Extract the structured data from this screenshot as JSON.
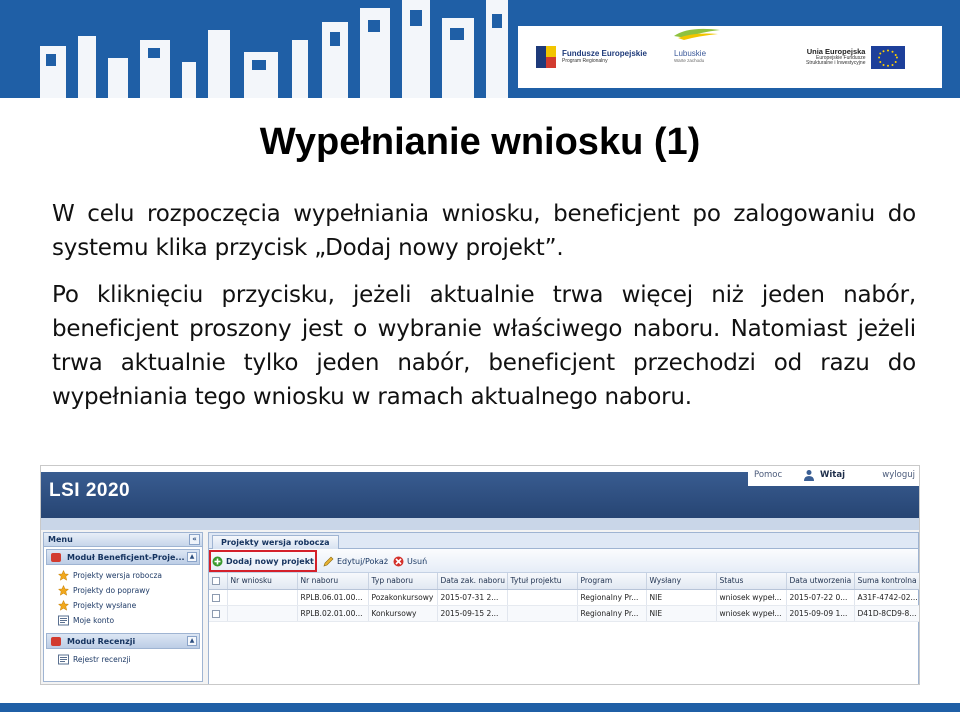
{
  "slide": {
    "title": "Wypełnianie wniosku (1)",
    "paragraph1": "W celu rozpoczęcia wypełniania wniosku, beneficjent po zalogowaniu do systemu klika przycisk „Dodaj nowy projekt”.",
    "paragraph2": "Po kliknięciu przycisku, jeżeli aktualnie trwa więcej niż jeden nabór, beneficjent proszony jest o wybranie właściwego naboru. Natomiast jeżeli trwa aktualnie tylko jeden nabór, beneficjent przechodzi od razu do wypełniania tego wniosku w ramach aktualnego naboru."
  },
  "logos": {
    "funds_name": "Fundusze Europejskie",
    "funds_sub": "Program Regionalny",
    "region_name": "Lubuskie",
    "region_sub": "Warte zachodu",
    "eu_name": "Unia Europejska",
    "eu_sub1": "Europejskie Fundusze",
    "eu_sub2": "Strukturalne i Inwestycyjne"
  },
  "app": {
    "logo": "LSI 2020",
    "topbar": {
      "help": "Pomoc",
      "hello": "Witaj",
      "logout": "wyloguj"
    },
    "menu": {
      "title": "Menu",
      "collapse": "«",
      "module1": {
        "title": "Moduł Beneficjent-Proje...",
        "items": [
          "Projekty wersja robocza",
          "Projekty do poprawy",
          "Projekty wysłane",
          "Moje konto"
        ]
      },
      "module2": {
        "title": "Moduł Recenzji",
        "items": [
          "Rejestr recenzji"
        ]
      }
    },
    "main": {
      "tab": "Projekty wersja robocza",
      "toolbar": {
        "add": "Dodaj nowy projekt",
        "edit": "Edytuj/Pokaż",
        "delete": "Usuń"
      },
      "columns": [
        "Nr wniosku",
        "Nr naboru",
        "Typ naboru",
        "Data zak. naboru",
        "Tytuł projektu",
        "Program",
        "Wysłany",
        "Status",
        "Data utworzenia",
        "Suma kontrolna"
      ],
      "rows": [
        [
          "",
          "RPLB.06.01.00...",
          "Pozakonkursowy",
          "2015-07-31 2...",
          "",
          "Regionalny Pr...",
          "NIE",
          "wniosek wypeł...",
          "2015-07-22 0...",
          "A31F-4742-02..."
        ],
        [
          "",
          "RPLB.02.01.00...",
          "Konkursowy",
          "2015-09-15 2...",
          "",
          "Regionalny Pr...",
          "NIE",
          "wniosek wypeł...",
          "2015-09-09 1...",
          "D41D-8CD9-8..."
        ]
      ]
    }
  },
  "colors": {
    "brand_blue": "#1f5fa6",
    "app_header": "#2e4f82",
    "highlight_red": "#d4202a"
  }
}
